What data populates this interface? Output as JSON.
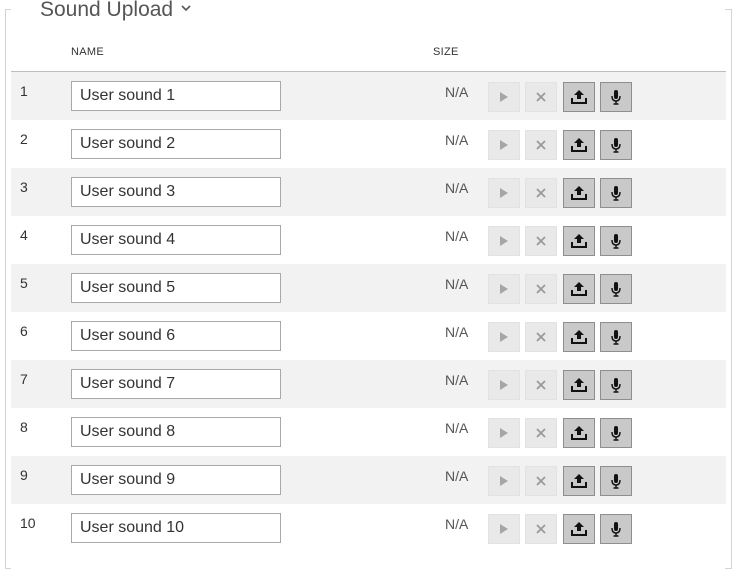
{
  "section": {
    "title": "Sound Upload"
  },
  "columns": {
    "name": "NAME",
    "size": "SIZE"
  },
  "rows": [
    {
      "index": "1",
      "name": "User sound 1",
      "size": "N/A"
    },
    {
      "index": "2",
      "name": "User sound 2",
      "size": "N/A"
    },
    {
      "index": "3",
      "name": "User sound 3",
      "size": "N/A"
    },
    {
      "index": "4",
      "name": "User sound 4",
      "size": "N/A"
    },
    {
      "index": "5",
      "name": "User sound 5",
      "size": "N/A"
    },
    {
      "index": "6",
      "name": "User sound 6",
      "size": "N/A"
    },
    {
      "index": "7",
      "name": "User sound 7",
      "size": "N/A"
    },
    {
      "index": "8",
      "name": "User sound 8",
      "size": "N/A"
    },
    {
      "index": "9",
      "name": "User sound 9",
      "size": "N/A"
    },
    {
      "index": "10",
      "name": "User sound 10",
      "size": "N/A"
    }
  ],
  "icons": {
    "play": "play-icon",
    "delete": "close-icon",
    "upload": "upload-icon",
    "record": "microphone-icon",
    "collapse": "chevron-down-icon"
  },
  "colors": {
    "stripe": "#f2f2f2",
    "button_disabled": "#e9e9e9",
    "button_active": "#c9c9c9"
  }
}
